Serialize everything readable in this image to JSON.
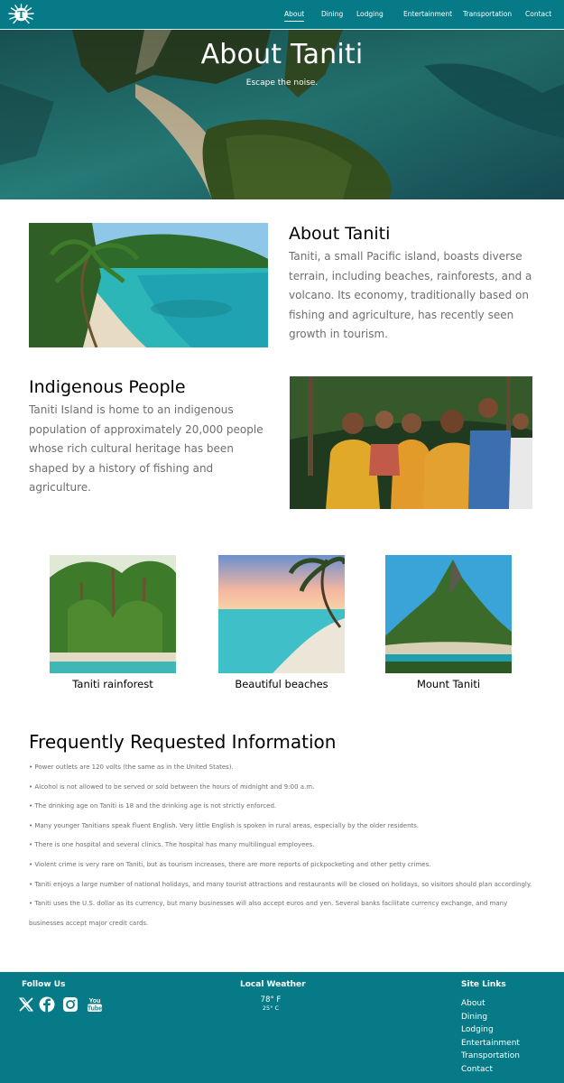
{
  "nav": {
    "logo": "taniti-logo",
    "links": [
      "About",
      "Dining",
      "Lodging",
      "Entertainment",
      "Transportation",
      "Contact"
    ],
    "active": "About"
  },
  "hero": {
    "title": "About Taniti",
    "subtitle": "Escape the noise."
  },
  "about": {
    "heading": "About Taniti",
    "text": "Taniti, a small Pacific island, boasts diverse terrain, including beaches, rainforests, and a volcano.  Its economy, traditionally based on fishing and agriculture, has recently seen growth in tourism."
  },
  "people": {
    "heading": "Indigenous People",
    "text": "Taniti Island is home to an indigenous population of approximately 20,000 people whose rich cultural heritage has been shaped by a history of fishing and agriculture."
  },
  "gallery": [
    {
      "caption": "Taniti rainforest"
    },
    {
      "caption": "Beautiful beaches"
    },
    {
      "caption": "Mount Taniti"
    }
  ],
  "faq": {
    "heading": "Frequently Requested Information",
    "items": [
      "• Power outlets are 120 volts (the same as in the United States).",
      "• Alcohol is not allowed to be served or sold between the hours of midnight and 9:00 a.m.",
      "• The drinking age on Taniti is 18 and the drinking age is not strictly enforced.",
      "• Many younger Tanitians speak fluent English. Very little English is spoken in rural areas, especially by the older residents.",
      "• There is one hospital and several clinics. The hospital has many multilingual employees.",
      "• Violent crime is very rare on Taniti, but as tourism increases, there are more reports of pickpocketing and other petty crimes.",
      "• Taniti enjoys a large number of national holidays, and many tourist attractions and restaurants will be closed on holidays, so visitors should plan accordingly.",
      "• Taniti uses the U.S. dollar as its currency, but many businesses will also accept euros and yen. Several banks facilitate currency exchange, and many businesses accept major credit cards."
    ]
  },
  "footer": {
    "follow_heading": "Follow Us",
    "social_icons": [
      "x-icon",
      "facebook-icon",
      "instagram-icon",
      "youtube-icon"
    ],
    "youtube_text": "You Tube",
    "weather_heading": "Local Weather",
    "temp_f": "78° F",
    "temp_c": "25° C",
    "links_heading": "Site Links",
    "links": [
      "About",
      "Dining",
      "Lodging",
      "Entertainment",
      "Transportation",
      "Contact"
    ]
  },
  "colors": {
    "brand_teal": "#067a86",
    "body_text": "#6e6e6e"
  }
}
